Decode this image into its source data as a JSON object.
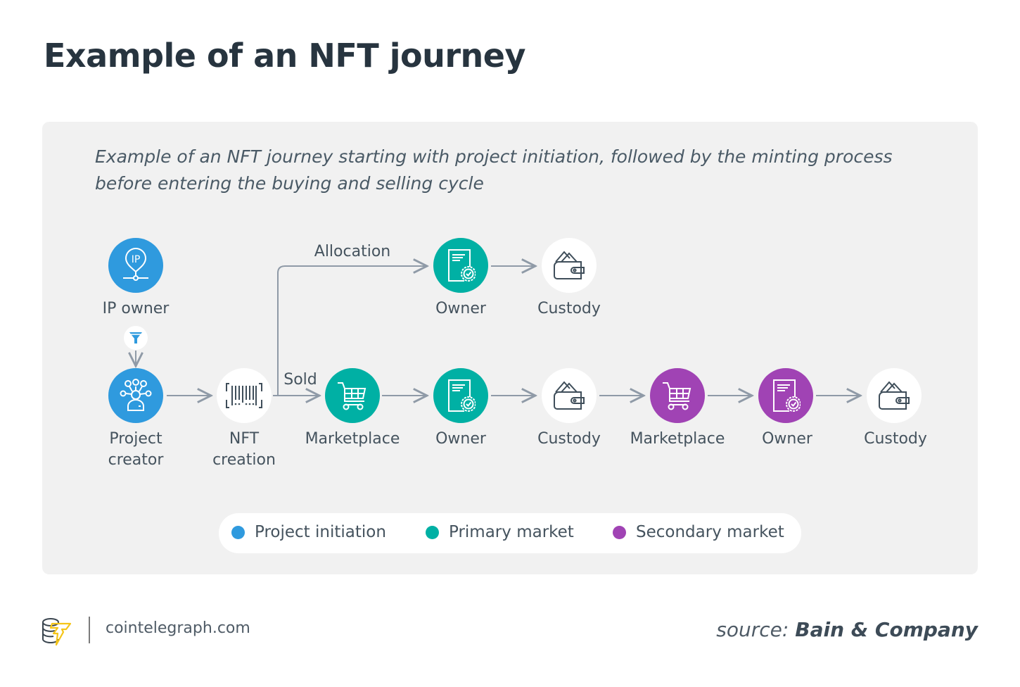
{
  "title": "Example of an NFT journey",
  "subtitle": "Example of an NFT journey starting with project initiation, followed by the minting process before entering the buying and selling cycle",
  "colors": {
    "project_initiation": "#2f9ade",
    "primary_market": "#00b0a4",
    "secondary_market": "#a043b4",
    "neutral": "#ffffff",
    "arrow": "#8f9aa7"
  },
  "nodes": {
    "ip_owner": {
      "label": "IP owner",
      "icon": "ip-pin-icon",
      "category": "project_initiation"
    },
    "project_creator": {
      "label": "Project creator",
      "line1": "Project",
      "line2": "creator",
      "icon": "team-network-icon",
      "category": "project_initiation"
    },
    "nft_creation": {
      "label": "NFT creation",
      "line1": "NFT",
      "line2": "creation",
      "icon": "barcode-icon",
      "category": "neutral"
    },
    "owner_alloc": {
      "label": "Owner",
      "icon": "certificate-icon",
      "category": "primary_market"
    },
    "custody_alloc": {
      "label": "Custody",
      "icon": "wallet-icon",
      "category": "neutral"
    },
    "marketplace_1": {
      "label": "Marketplace",
      "icon": "cart-icon",
      "category": "primary_market"
    },
    "owner_1": {
      "label": "Owner",
      "icon": "certificate-icon",
      "category": "primary_market"
    },
    "custody_1": {
      "label": "Custody",
      "icon": "wallet-icon",
      "category": "neutral"
    },
    "marketplace_2": {
      "label": "Marketplace",
      "icon": "cart-icon",
      "category": "secondary_market"
    },
    "owner_2": {
      "label": "Owner",
      "icon": "certificate-icon",
      "category": "secondary_market"
    },
    "custody_2": {
      "label": "Custody",
      "icon": "wallet-icon",
      "category": "neutral"
    }
  },
  "edges": [
    {
      "from": "ip_owner",
      "to": "project_creator",
      "via": "filter-icon",
      "label": ""
    },
    {
      "from": "project_creator",
      "to": "nft_creation",
      "label": ""
    },
    {
      "from": "nft_creation",
      "to": "owner_alloc",
      "label": "Allocation"
    },
    {
      "from": "owner_alloc",
      "to": "custody_alloc",
      "label": ""
    },
    {
      "from": "nft_creation",
      "to": "marketplace_1",
      "label": "Sold"
    },
    {
      "from": "marketplace_1",
      "to": "owner_1",
      "label": ""
    },
    {
      "from": "owner_1",
      "to": "custody_1",
      "label": ""
    },
    {
      "from": "custody_1",
      "to": "marketplace_2",
      "label": ""
    },
    {
      "from": "marketplace_2",
      "to": "owner_2",
      "label": ""
    },
    {
      "from": "owner_2",
      "to": "custody_2",
      "label": ""
    }
  ],
  "edge_labels": {
    "allocation": "Allocation",
    "sold": "Sold"
  },
  "legend": [
    {
      "label": "Project initiation",
      "color": "#2f9ade"
    },
    {
      "label": "Primary market",
      "color": "#00b0a4"
    },
    {
      "label": "Secondary market",
      "color": "#a043b4"
    }
  ],
  "footer": {
    "site": "cointelegraph.com",
    "source_prefix": "source:",
    "source_name": "Bain & Company"
  }
}
